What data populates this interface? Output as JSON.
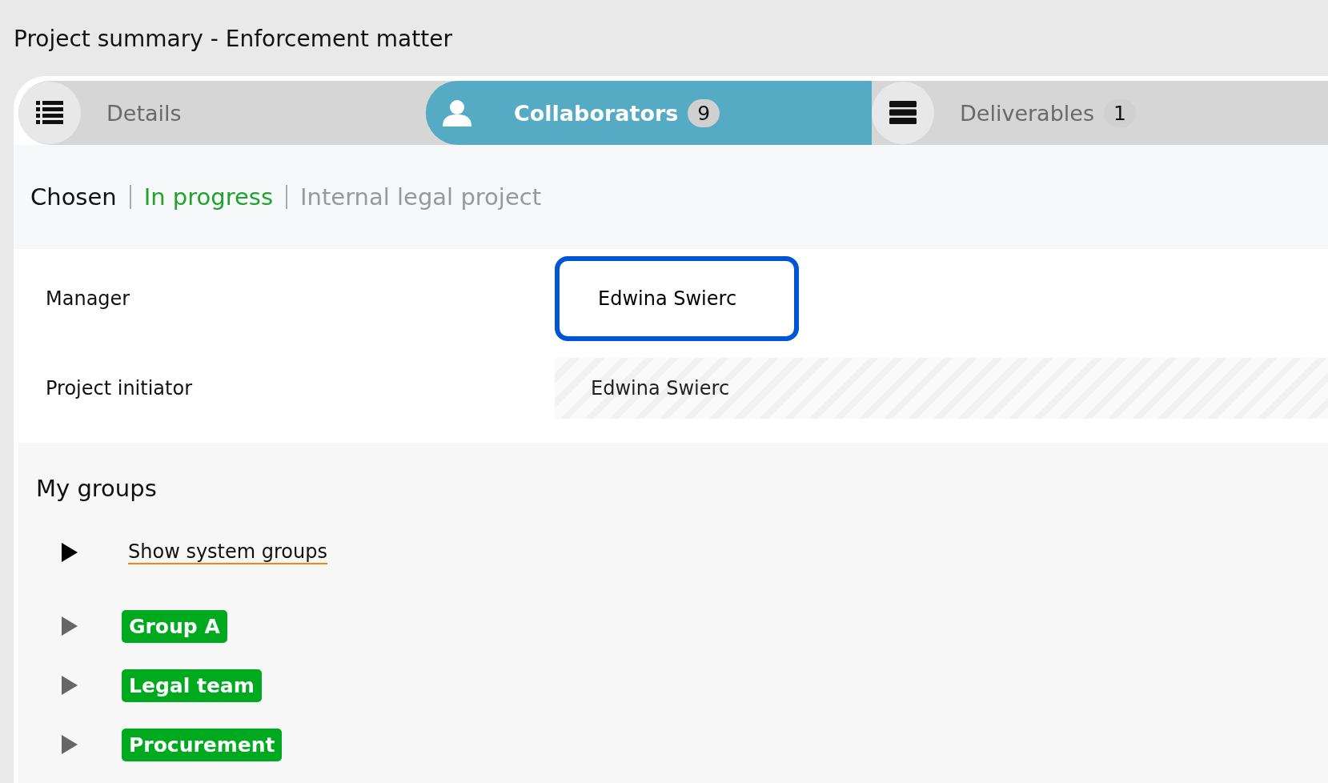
{
  "window": {
    "title": "Project summary - Enforcement matter"
  },
  "tabs": [
    {
      "label": "Details",
      "selected": false
    },
    {
      "label": "Collaborators",
      "selected": true,
      "count": "9"
    },
    {
      "label": "Deliverables",
      "selected": false,
      "count": "1"
    }
  ],
  "status": [
    {
      "text": "Chosen",
      "kind": "stage"
    },
    {
      "text": "In progress",
      "kind": "state"
    },
    {
      "text": "Internal legal project",
      "kind": "type"
    }
  ],
  "fields": [
    {
      "label": "Manager",
      "value": "Edwina Swierc",
      "kind": "focused"
    },
    {
      "label": "Project initiator",
      "value": "Edwina Swierc",
      "kind": "readonly"
    }
  ],
  "groups_section": {
    "title": "My groups",
    "system_toggle": {
      "label": "Show system groups",
      "expanded": false
    },
    "groups": [
      {
        "name": "Group A",
        "expanded": false
      },
      {
        "name": "Legal team",
        "expanded": false
      },
      {
        "name": "Procurement",
        "expanded": false
      }
    ]
  }
}
